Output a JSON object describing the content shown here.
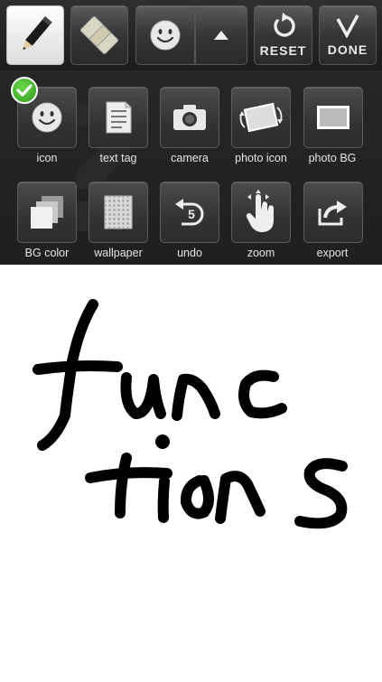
{
  "toolbar": {
    "reset_label": "RESET",
    "done_label": "DONE"
  },
  "panel": {
    "tiles": [
      {
        "label": "icon",
        "icon": "smiley-icon"
      },
      {
        "label": "text tag",
        "icon": "document-icon"
      },
      {
        "label": "camera",
        "icon": "camera-icon"
      },
      {
        "label": "photo icon",
        "icon": "rotate-photo-icon"
      },
      {
        "label": "photo BG",
        "icon": "photo-frame-icon"
      },
      {
        "label": "BG color",
        "icon": "stacked-squares-icon"
      },
      {
        "label": "wallpaper",
        "icon": "pattern-icon"
      },
      {
        "label": "undo",
        "icon": "undo-icon",
        "badge": "5"
      },
      {
        "label": "zoom",
        "icon": "hand-zoom-icon"
      },
      {
        "label": "export",
        "icon": "share-icon"
      }
    ]
  },
  "colors": {
    "toolbar_bg": "#262626",
    "active_tool_bg": "#ffffff",
    "check_green": "#3aa82a",
    "ink": "#000000"
  }
}
